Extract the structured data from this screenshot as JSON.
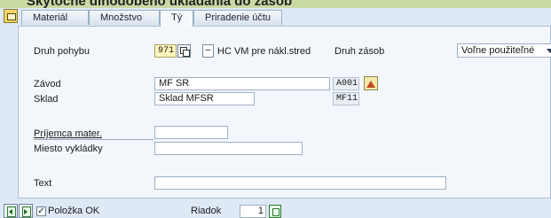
{
  "header": {
    "caption": "Skytočné dlhodobého ukladania do zásob"
  },
  "tabs": [
    {
      "label": "Materiál",
      "active": false
    },
    {
      "label": "Množstvo",
      "active": false
    },
    {
      "label": "Tý",
      "active": true
    },
    {
      "label": "Priradenie účtu",
      "active": false
    }
  ],
  "form": {
    "druh_pohybu": {
      "label": "Druh pohybu",
      "value": "971",
      "text": "HC VM pre nákl.stred"
    },
    "druh_zasob": {
      "label": "Druh zásob",
      "value": "Voľne použiteľné"
    },
    "zavod": {
      "label": "Závod",
      "value": "MF SR",
      "code": "A001"
    },
    "sklad": {
      "label": "Sklad",
      "value": "Sklad MFSR",
      "code": "MF11"
    },
    "prijemca": {
      "label": "Príjemca mater.",
      "value": ""
    },
    "miesto": {
      "label": "Miesto vykládky",
      "value": ""
    },
    "text": {
      "label": "Text",
      "value": ""
    }
  },
  "footer": {
    "polozka_ok_label": "Položka OK",
    "polozka_ok_checked": true,
    "riadok_label": "Riadok",
    "riadok_value": "1"
  },
  "icons": {
    "side": "document-icon",
    "copy": "copy-icon",
    "mount": "mountain-icon",
    "prev": "previous-item-icon",
    "next": "next-item-icon",
    "nav": "navigate-icon"
  }
}
